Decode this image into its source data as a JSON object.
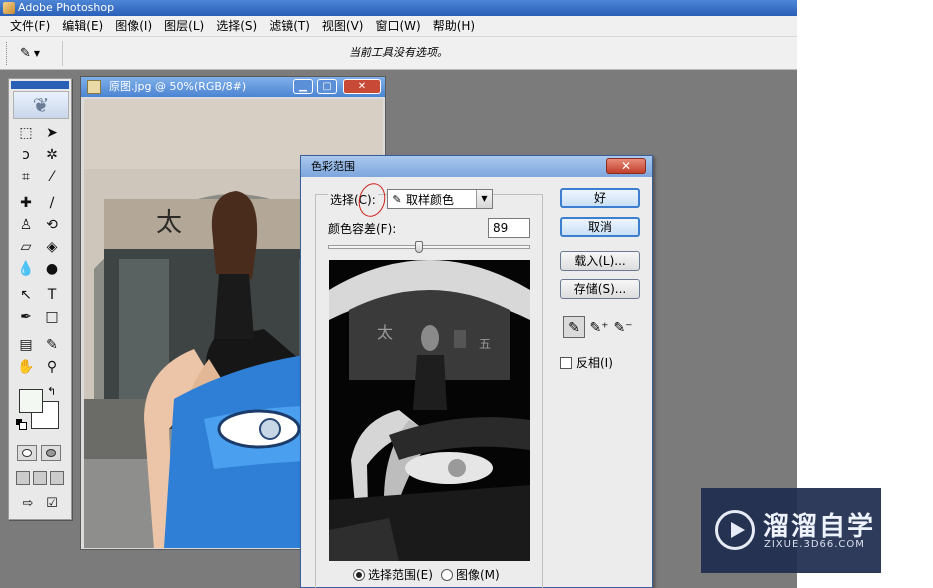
{
  "app": {
    "title": "Adobe Photoshop"
  },
  "menu": [
    "文件(F)",
    "编辑(E)",
    "图像(I)",
    "图层(L)",
    "选择(S)",
    "滤镜(T)",
    "视图(V)",
    "窗口(W)",
    "帮助(H)"
  ],
  "options_bar": {
    "message": "当前工具没有选项。",
    "tool_icon": "eyedropper-icon"
  },
  "toolbox": {
    "tools": [
      "marquee-icon",
      "move-icon",
      "lasso-icon",
      "magic-wand-icon",
      "crop-icon",
      "slice-icon",
      "healing-icon",
      "brush-icon",
      "stamp-icon",
      "history-brush-icon",
      "eraser-icon",
      "paint-bucket-icon",
      "blur-icon",
      "dodge-icon",
      "path-select-icon",
      "type-icon",
      "pen-icon",
      "rectangle-icon",
      "notes-icon",
      "eyedropper-icon",
      "hand-icon",
      "zoom-icon"
    ],
    "foreground_color": "#f3f8f2",
    "background_color": "#ffffff"
  },
  "document": {
    "title": "原图.jpg @ 50%(RGB/8#)"
  },
  "dialog": {
    "title": "色彩范围",
    "select_label": "选择(C):",
    "select_value": "取样颜色",
    "fuzziness_label": "颜色容差(F):",
    "fuzziness_value": "89",
    "fuzziness_fraction": 0.45,
    "buttons": {
      "ok": "好",
      "cancel": "取消",
      "load": "载入(L)...",
      "save": "存储(S)..."
    },
    "invert_label": "反相(I)",
    "invert_checked": false,
    "preview_options": [
      "选择范围(E)",
      "图像(M)"
    ],
    "preview_selected": 0
  },
  "watermark": {
    "name": "溜溜自学",
    "url": "ZIXUE.3D66.COM"
  }
}
